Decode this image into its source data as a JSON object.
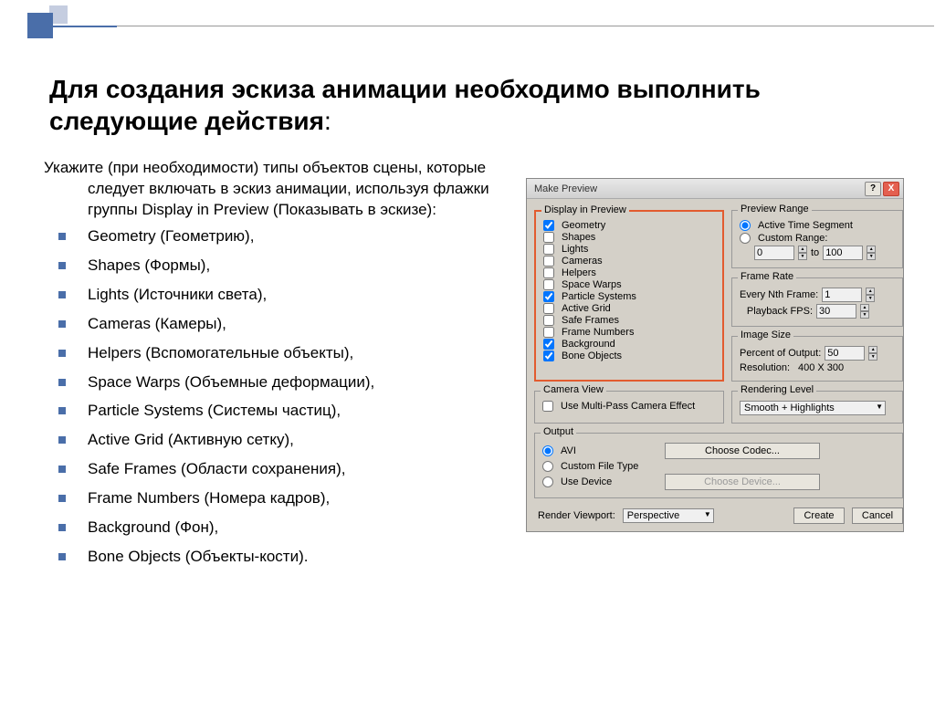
{
  "slide": {
    "title": "Для создания эскиза анимации необходимо выполнить следующие действия",
    "colon": ":",
    "intro": "Укажите (при необходимости) типы объектов сцены, которые следует включать в эскиз анимации, используя флажки группы Display in Preview (Показывать в эскизе):",
    "bullets": [
      "Geometry (Геометрию),",
      " Shapes (Формы),",
      "Lights (Источники света),",
      "Cameras (Камеры),",
      " Helpers (Вспомогательные объекты),",
      "Space Warps (Объемные деформации),",
      " Particle Systems (Системы частиц),",
      "Active Grid (Активную сетку),",
      "Safe Frames (Области сохранения),",
      "Frame Numbers (Номера кадров),",
      " Background (Фон),",
      "Bone Objects (Объекты-кости)."
    ]
  },
  "dialog": {
    "title": "Make Preview",
    "help": "?",
    "close": "X",
    "previewRange": {
      "legend": "Preview Range",
      "active": "Active Time Segment",
      "custom": "Custom Range:",
      "from": "0",
      "to_label": "to",
      "to": "100"
    },
    "frameRate": {
      "legend": "Frame Rate",
      "nth": "Every Nth Frame:",
      "nth_val": "1",
      "fps": "Playback FPS:",
      "fps_val": "30"
    },
    "imageSize": {
      "legend": "Image Size",
      "percent": "Percent of Output:",
      "percent_val": "50",
      "resolution_label": "Resolution:",
      "resolution_val": "400  X  300"
    },
    "cameraView": {
      "legend": "Camera View",
      "multipass": "Use Multi-Pass Camera Effect"
    },
    "display": {
      "legend": "Display in Preview",
      "items": [
        {
          "label": "Geometry",
          "checked": true
        },
        {
          "label": "Shapes",
          "checked": false
        },
        {
          "label": "Lights",
          "checked": false
        },
        {
          "label": "Cameras",
          "checked": false
        },
        {
          "label": "Helpers",
          "checked": false
        },
        {
          "label": "Space Warps",
          "checked": false
        },
        {
          "label": "Particle Systems",
          "checked": true
        },
        {
          "label": "Active Grid",
          "checked": false
        },
        {
          "label": "Safe Frames",
          "checked": false
        },
        {
          "label": "Frame Numbers",
          "checked": false
        },
        {
          "label": "Background",
          "checked": true
        },
        {
          "label": "Bone Objects",
          "checked": true
        }
      ]
    },
    "renderLevel": {
      "legend": "Rendering Level",
      "value": "Smooth + Highlights"
    },
    "output": {
      "legend": "Output",
      "avi": "AVI",
      "codec": "Choose Codec...",
      "custom": "Custom File Type",
      "device": "Use Device",
      "device_btn": "Choose Device..."
    },
    "bottom": {
      "viewport_label": "Render Viewport:",
      "viewport_val": "Perspective",
      "create": "Create",
      "cancel": "Cancel"
    }
  }
}
